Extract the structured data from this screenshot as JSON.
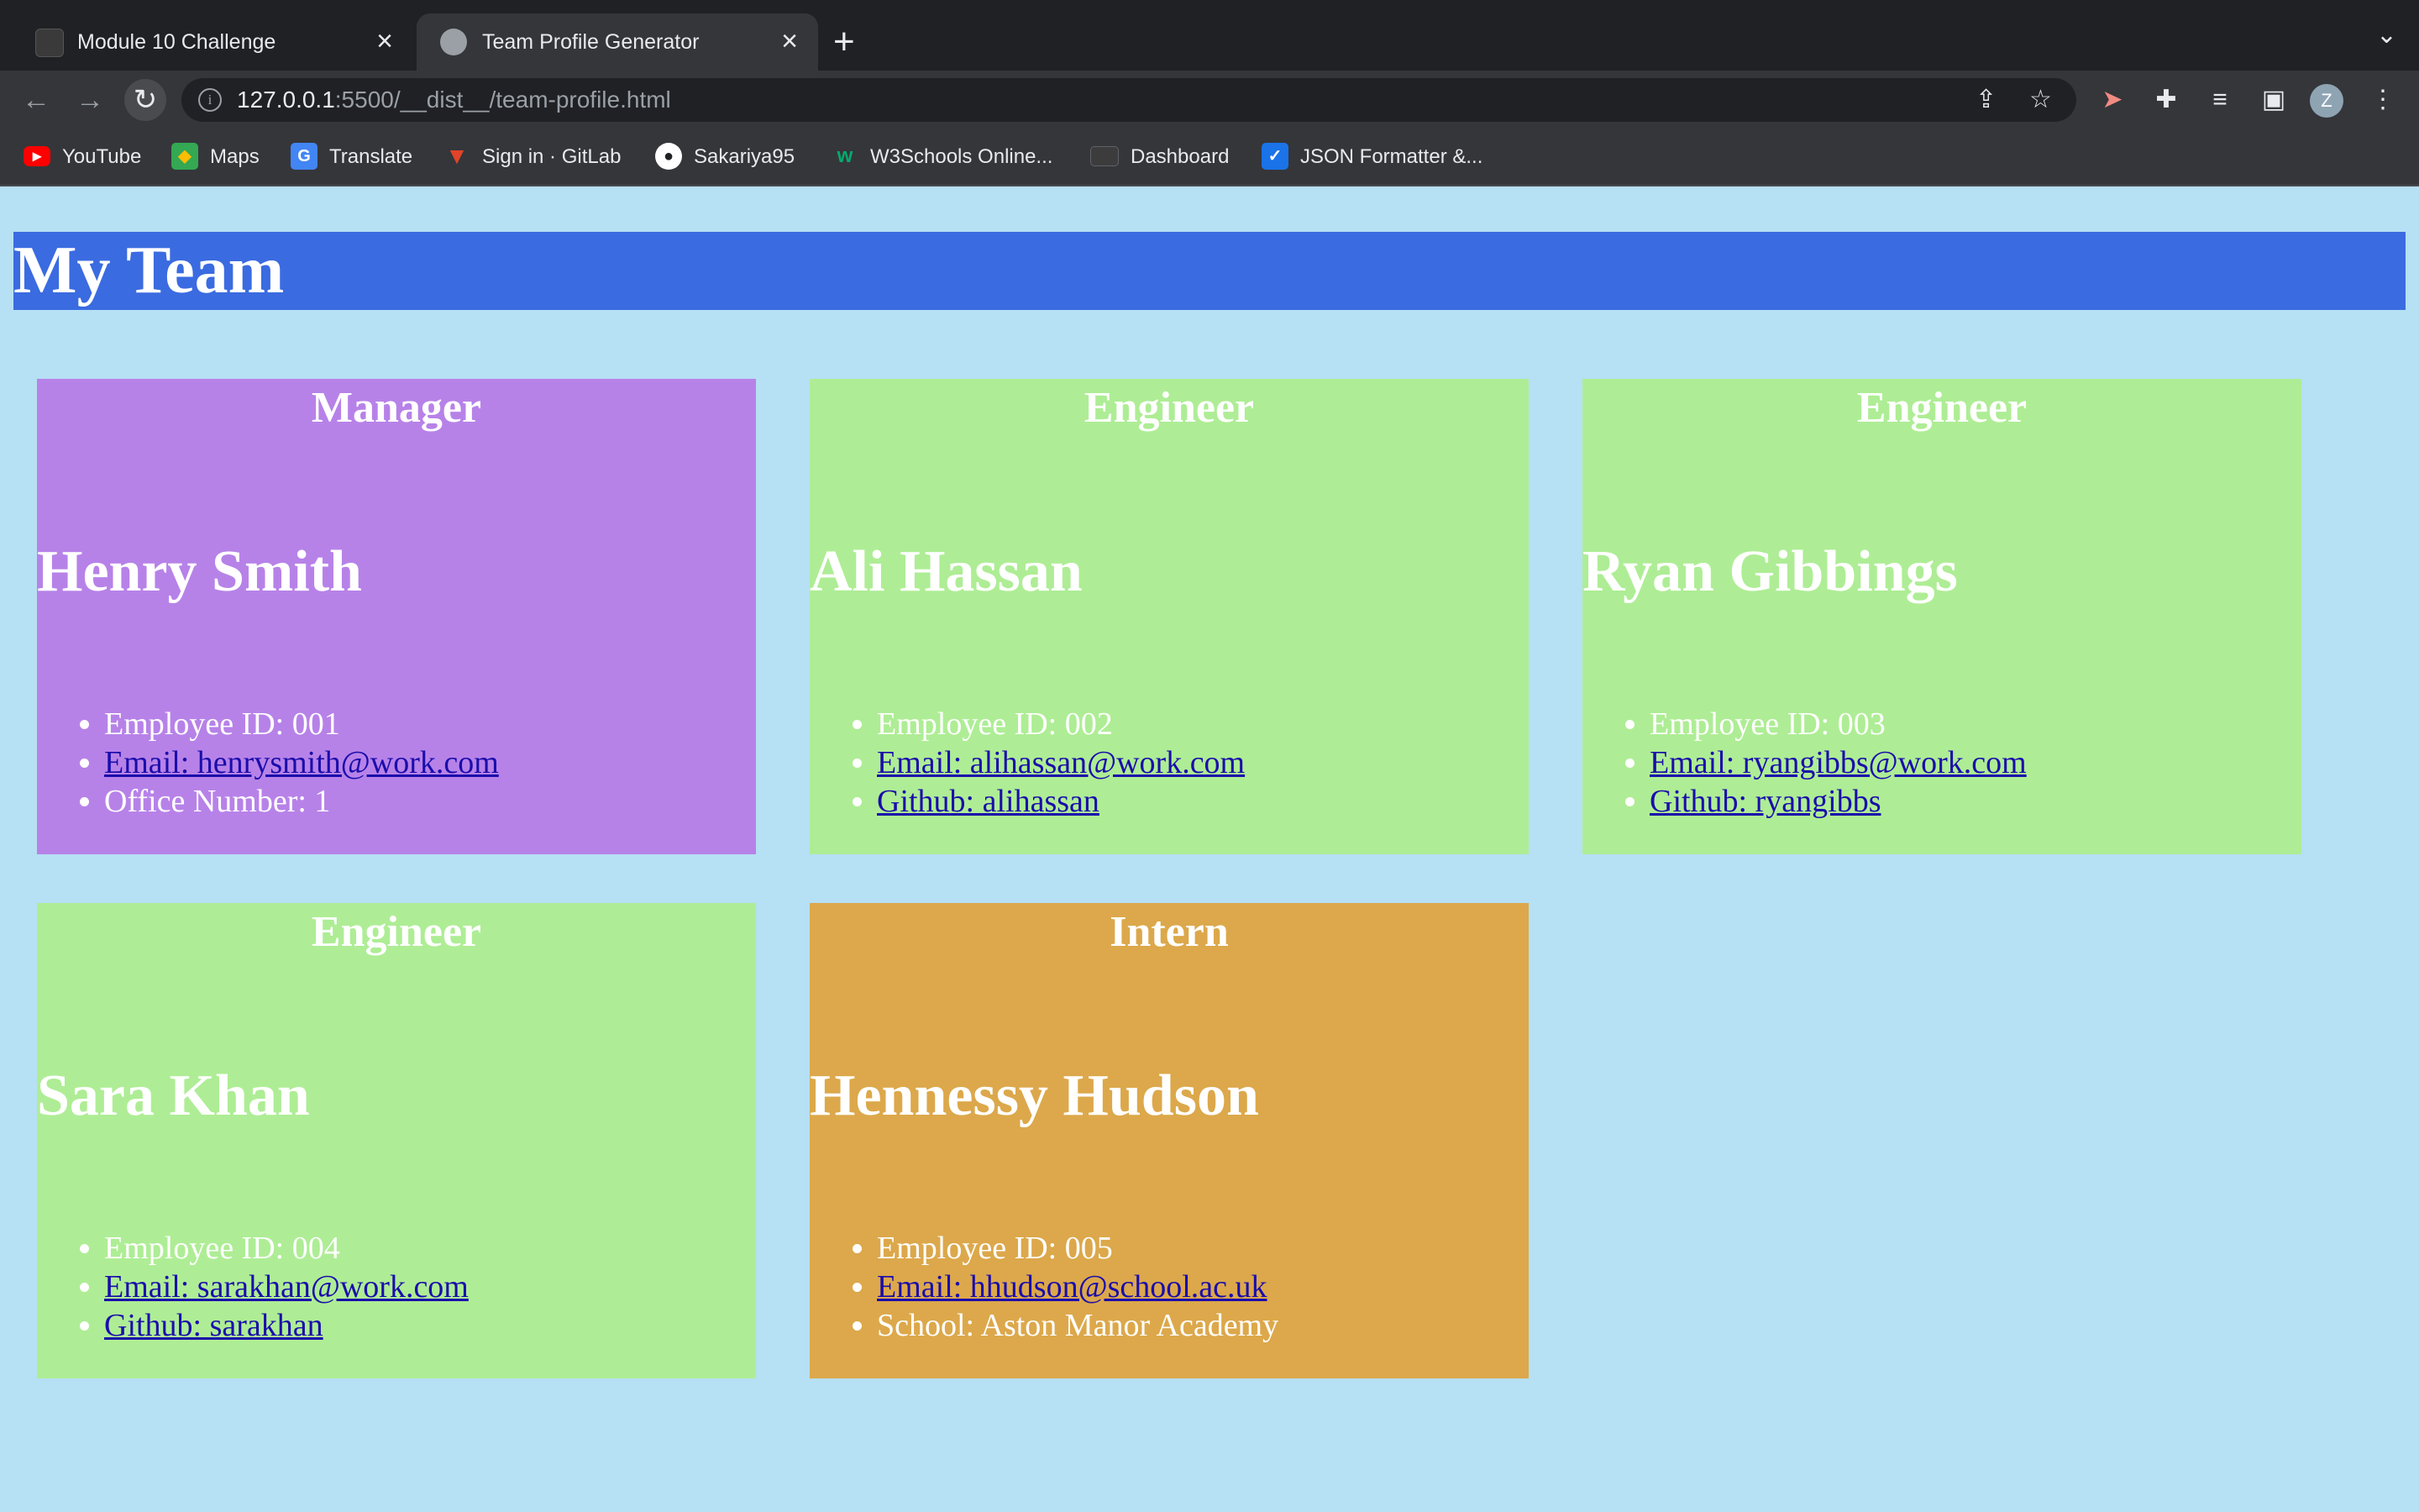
{
  "browser": {
    "tabs": [
      {
        "title": "Module 10 Challenge",
        "active": false
      },
      {
        "title": "Team Profile Generator",
        "active": true
      }
    ],
    "new_tab_icon": "plus-icon",
    "url_host": "127.0.0.1",
    "url_rest": ":5500/__dist__/team-profile.html",
    "bookmarks": [
      {
        "label": "YouTube",
        "icon": "youtube-icon",
        "color": "#ff0000"
      },
      {
        "label": "Maps",
        "icon": "maps-icon",
        "color": "#34a853"
      },
      {
        "label": "Translate",
        "icon": "translate-icon",
        "color": "#4285f4"
      },
      {
        "label": "Sign in · GitLab",
        "icon": "gitlab-icon",
        "color": "#e24329"
      },
      {
        "label": "Sakariya95",
        "icon": "github-icon",
        "color": "#ffffff"
      },
      {
        "label": "W3Schools Online...",
        "icon": "w3schools-icon",
        "color": "#04aa6d"
      },
      {
        "label": "Dashboard",
        "icon": "dashboard-icon",
        "color": "#5f6368"
      },
      {
        "label": "JSON Formatter &...",
        "icon": "json-formatter-icon",
        "color": "#1a73e8"
      }
    ],
    "avatar_letter": "Z"
  },
  "page": {
    "title": "My Team",
    "colors": {
      "background": "#b6e0f4",
      "header": "#3a6be0",
      "manager": "#b782e8",
      "engineer": "#aeed95",
      "intern": "#dca84b",
      "link": "#1a0dab"
    },
    "cards": [
      {
        "role": "Manager",
        "name": "Henry Smith",
        "id": "Employee ID: 001",
        "email": "Email: henrysmith@work.com",
        "extra": "Office Number: 1",
        "extra_is_link": false
      },
      {
        "role": "Engineer",
        "name": "Ali Hassan",
        "id": "Employee ID: 002",
        "email": "Email: alihassan@work.com",
        "extra": "Github: alihassan",
        "extra_is_link": true
      },
      {
        "role": "Engineer",
        "name": "Ryan Gibbings",
        "id": "Employee ID: 003",
        "email": "Email: ryangibbs@work.com",
        "extra": "Github: ryangibbs",
        "extra_is_link": true
      },
      {
        "role": "Engineer",
        "name": "Sara Khan",
        "id": "Employee ID: 004",
        "email": "Email: sarakhan@work.com",
        "extra": "Github: sarakhan",
        "extra_is_link": true
      },
      {
        "role": "Intern",
        "name": "Hennessy Hudson",
        "id": "Employee ID: 005",
        "email": "Email: hhudson@school.ac.uk",
        "extra": "School: Aston Manor Academy",
        "extra_is_link": false
      }
    ]
  }
}
